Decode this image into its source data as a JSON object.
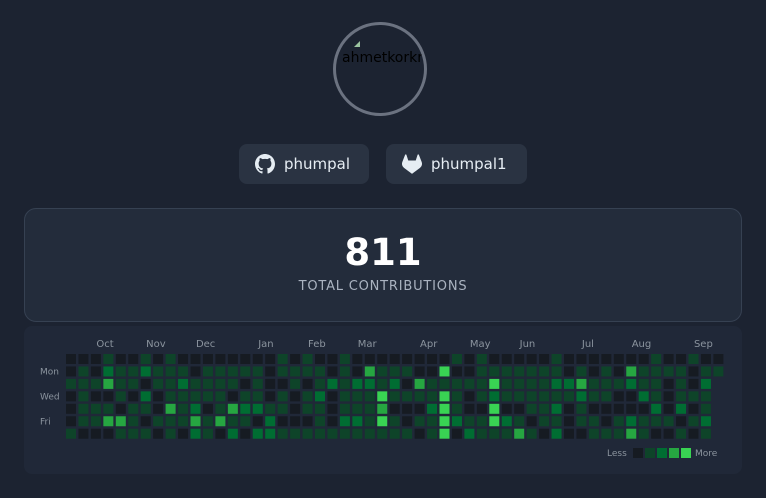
{
  "profile": {
    "avatar_alt": "ahmetkorkmaz"
  },
  "accounts": [
    {
      "platform": "github",
      "username": "phumpal",
      "icon": "github-icon"
    },
    {
      "platform": "gitlab",
      "username": "phumpal1",
      "icon": "gitlab-icon"
    }
  ],
  "stats": {
    "total": "811",
    "total_label": "TOTAL CONTRIBUTIONS"
  },
  "graph": {
    "months": [
      "Oct",
      "Nov",
      "Dec",
      "Jan",
      "Feb",
      "Mar",
      "Apr",
      "May",
      "Jun",
      "Jul",
      "Aug",
      "Sep"
    ],
    "month_week_index": [
      3,
      7,
      11,
      16,
      20,
      24,
      29,
      33,
      37,
      42,
      46,
      51
    ],
    "days": [
      "Mon",
      "Wed",
      "Fri"
    ],
    "legend": {
      "less": "Less",
      "more": "More"
    },
    "colors": [
      "#161b22",
      "#0e4429",
      "#006d32",
      "#26a641",
      "#39d353"
    ],
    "weeks": 53
  }
}
